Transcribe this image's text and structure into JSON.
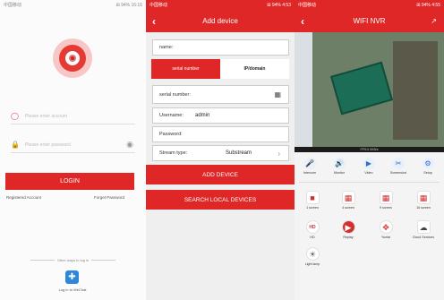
{
  "login": {
    "status_left": "中国移动",
    "status_right": "⊞ 94% 16:16",
    "username_placeholder": "Please enter account",
    "password_placeholder": "Please enter password",
    "login_label": "LOGIN",
    "registered": "Registered Account",
    "forgot": "Forget Password",
    "other_ways": "Other ways to log in",
    "wechat_label": "Log in to WeChat"
  },
  "add_device": {
    "status_left": "中国移动",
    "status_right": "⊞ 94% 4:53",
    "title": "Add device",
    "name_label": "name:",
    "tab_serial": "serial number",
    "tab_ip": "IP/domain",
    "serial_label": "serial number:",
    "username_label": "Username:",
    "username_value": "admin",
    "password_label": "Password:",
    "stream_label": "Stream type:",
    "stream_value": "Substream",
    "add_button": "ADD DEVICE",
    "search_button": "SEARCH LOCAL DEVICES"
  },
  "nvr": {
    "status_left": "中国移动",
    "status_right": "⊞ 94% 4:55",
    "title": "WIFI NVR",
    "video_caption": "FPS:0 0KB/s",
    "controls": [
      "Intercom",
      "Monitor",
      "Video",
      "Screenshot",
      "Setup"
    ],
    "tiles_row1": [
      "1 screen",
      "4 screen",
      "9 screen",
      "16 screen"
    ],
    "tiles_row2": [
      "HD",
      "Replay",
      "Yuntai",
      "Cloud Services"
    ],
    "tiles_row3": [
      "Light lamp"
    ]
  },
  "colors": {
    "accent": "#e02727",
    "link_blue": "#2f6fc4"
  }
}
